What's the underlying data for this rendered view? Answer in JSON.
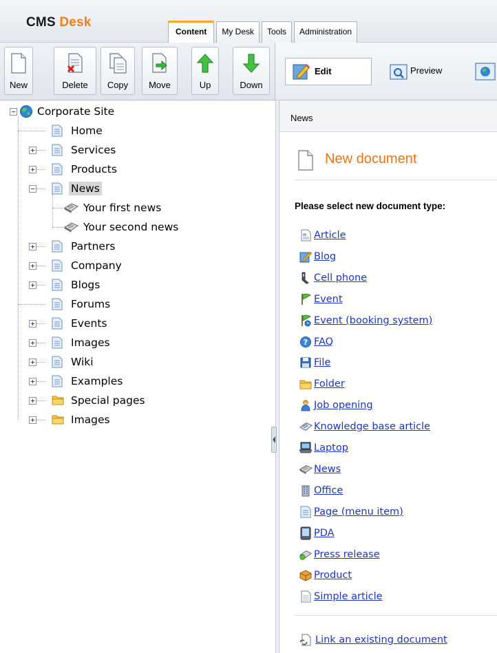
{
  "app": {
    "brand_cms": "CMS",
    "brand_desk": "Desk"
  },
  "tabs": [
    {
      "label": "Content",
      "active": true
    },
    {
      "label": "My Desk",
      "active": false
    },
    {
      "label": "Tools",
      "active": false
    },
    {
      "label": "Administration",
      "active": false
    }
  ],
  "toolbar": {
    "new": "New",
    "delete": "Delete",
    "copy": "Copy",
    "move": "Move",
    "up": "Up",
    "down": "Down"
  },
  "view_modes": {
    "edit": "Edit",
    "preview": "Preview"
  },
  "tree": {
    "root": "Corporate Site",
    "items": [
      {
        "label": "Home",
        "icon": "page-icon",
        "expander": "none"
      },
      {
        "label": "Services",
        "icon": "page-icon",
        "expander": "plus"
      },
      {
        "label": "Products",
        "icon": "page-icon",
        "expander": "plus"
      },
      {
        "label": "News",
        "icon": "page-icon",
        "expander": "minus",
        "selected": true
      },
      {
        "label": "Your first news",
        "icon": "news-icon",
        "expander": "none"
      },
      {
        "label": "Your second news",
        "icon": "news-icon",
        "expander": "none"
      },
      {
        "label": "Partners",
        "icon": "page-icon",
        "expander": "plus"
      },
      {
        "label": "Company",
        "icon": "page-icon",
        "expander": "plus"
      },
      {
        "label": "Blogs",
        "icon": "page-icon",
        "expander": "plus"
      },
      {
        "label": "Forums",
        "icon": "page-icon",
        "expander": "none"
      },
      {
        "label": "Events",
        "icon": "page-icon",
        "expander": "plus"
      },
      {
        "label": "Images",
        "icon": "page-icon",
        "expander": "plus"
      },
      {
        "label": "Wiki",
        "icon": "page-icon",
        "expander": "plus"
      },
      {
        "label": "Examples",
        "icon": "page-icon",
        "expander": "plus"
      },
      {
        "label": "Special pages",
        "icon": "folder-icon",
        "expander": "plus"
      },
      {
        "label": "Images",
        "icon": "folder-icon",
        "expander": "plus"
      }
    ]
  },
  "content": {
    "breadcrumb": "News",
    "title": "New document",
    "prompt": "Please select new document type:",
    "doc_types": [
      {
        "label": "Article",
        "icon": "article-icon"
      },
      {
        "label": "Blog",
        "icon": "blog-icon"
      },
      {
        "label": "Cell phone",
        "icon": "cell-phone-icon"
      },
      {
        "label": "Event",
        "icon": "event-flag-icon"
      },
      {
        "label": "Event (booking system)",
        "icon": "event-booking-icon"
      },
      {
        "label": "FAQ",
        "icon": "faq-icon"
      },
      {
        "label": "File",
        "icon": "file-disk-icon"
      },
      {
        "label": "Folder",
        "icon": "folder-icon"
      },
      {
        "label": "Job opening",
        "icon": "job-opening-icon"
      },
      {
        "label": "Knowledge base article",
        "icon": "knowledge-base-icon"
      },
      {
        "label": "Laptop",
        "icon": "laptop-icon"
      },
      {
        "label": "News",
        "icon": "news-icon"
      },
      {
        "label": "Office",
        "icon": "office-building-icon"
      },
      {
        "label": "Page (menu item)",
        "icon": "page-icon"
      },
      {
        "label": "PDA",
        "icon": "pda-icon"
      },
      {
        "label": "Press release",
        "icon": "press-release-icon"
      },
      {
        "label": "Product",
        "icon": "product-icon"
      },
      {
        "label": "Simple article",
        "icon": "simple-article-icon"
      }
    ],
    "link_existing": "Link an existing document"
  },
  "colors": {
    "accent_orange": "#ee7413",
    "link_blue": "#1b36c2",
    "tab_highlight": "#f5a623"
  }
}
